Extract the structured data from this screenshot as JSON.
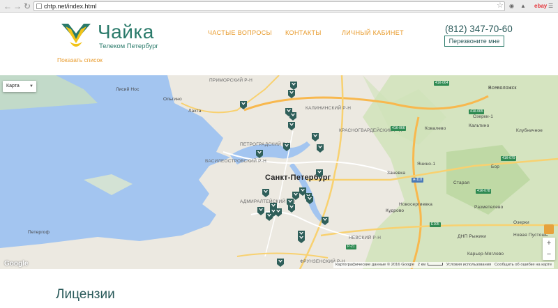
{
  "browser": {
    "url": "chtp.net/index.html",
    "extensions": [
      "ebay"
    ]
  },
  "header": {
    "logo": {
      "name": "Чайка",
      "tagline": "Телеком Петербург",
      "colors": {
        "yellow": "#f2c318",
        "teal": "#2a7a6a"
      }
    },
    "nav": [
      {
        "label": "ЧАСТЫЕ ВОПРОСЫ"
      },
      {
        "label": "КОНТАКТЫ"
      },
      {
        "label": "ЛИЧНЫЙ КАБИНЕТ"
      }
    ],
    "phone": "(812) 347-70-60",
    "callback_label": "Перезвоните мне",
    "show_list": "Показать список"
  },
  "map": {
    "type_selector": "Карта",
    "city": "Санкт-Петербург",
    "districts": [
      {
        "label": "ПРИМОРСКИЙ Р-Н"
      },
      {
        "label": "КАЛИНИНСКИЙ Р-Н"
      },
      {
        "label": "КРАСНОГВАРДЕЙСКИЙ Р-Н"
      },
      {
        "label": "ПЕТРОГРАДСКИЙ Р-Н"
      },
      {
        "label": "ВАСИЛЕОСТРОВСКИЙ Р-Н"
      },
      {
        "label": "АДМИРАЛТЕЙСКИЙ Р-Н"
      },
      {
        "label": "НЕВСКИЙ Р-Н"
      },
      {
        "label": "ФРУНЗЕНСКИЙ Р-Н"
      }
    ],
    "places": [
      {
        "label": "Лисий Нос"
      },
      {
        "label": "Ольгино"
      },
      {
        "label": "Лахта"
      },
      {
        "label": "Всеволожск"
      },
      {
        "label": "Озерки-1"
      },
      {
        "label": "Кальтино"
      },
      {
        "label": "Ковалево"
      },
      {
        "label": "Клубничное"
      },
      {
        "label": "Заневка"
      },
      {
        "label": "Янино-1"
      },
      {
        "label": "Бор"
      },
      {
        "label": "Кудрово"
      },
      {
        "label": "Старая"
      },
      {
        "label": "Новосергиевка"
      },
      {
        "label": "Разметелево"
      },
      {
        "label": "Петергоф"
      },
      {
        "label": "Озерки"
      },
      {
        "label": "ДНП Рыжики"
      },
      {
        "label": "Новая Пустошь"
      },
      {
        "label": "Карьер-Мяглово"
      }
    ],
    "roads": [
      "41К-064",
      "41К-065",
      "А-118",
      "Е105",
      "Р-21",
      "41К-079",
      "41К-078",
      "41К-066"
    ],
    "footer": {
      "attribution": "Картографические данные © 2016 Google",
      "scale": "2 км",
      "terms": "Условия использования",
      "report": "Сообщить об ошибке на карте"
    },
    "google": "Google",
    "marker_count": 27,
    "colors": {
      "water": "#a3c5f0",
      "marker": "#2f5f5a",
      "road_major": "#f8b84e"
    }
  },
  "section_title": "Лицензии"
}
